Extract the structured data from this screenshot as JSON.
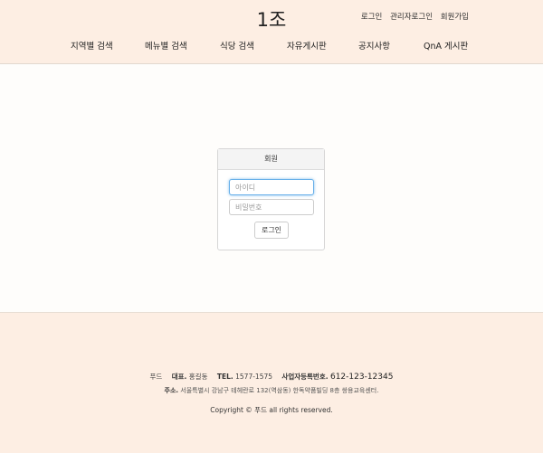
{
  "header": {
    "brand": "1조",
    "top_links": [
      "로그인",
      "관리자로그인",
      "회원가입"
    ],
    "nav": [
      "지역별 검색",
      "메뉴별 검색",
      "식당 검색",
      "자유게시판",
      "공지사항",
      "QnA 게시판"
    ]
  },
  "login": {
    "title": "회원",
    "id_placeholder": "아이디",
    "pw_placeholder": "비밀번호",
    "button": "로그인"
  },
  "footer": {
    "company": "푸드",
    "rep_label": "대표.",
    "rep_value": "홍길동",
    "tel_label": "TEL.",
    "tel_value": "1577-1575",
    "biz_label": "사업자등록번호.",
    "biz_value": "612-123-12345",
    "addr_label": "주소.",
    "addr_value": "서울특별시 강남구 테헤란로 132(역삼동) 한독약품빌딩 8층 쌍용교육센터.",
    "copyright": "Copyright © 푸드 all rights reserved."
  }
}
